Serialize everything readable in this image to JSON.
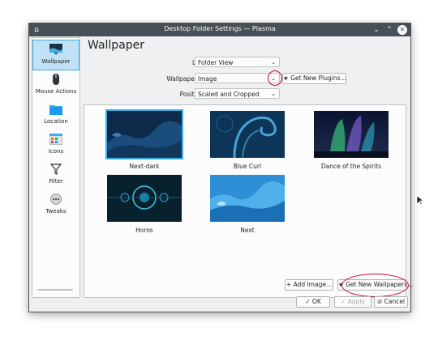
{
  "window": {
    "title": "Desktop Folder Settings — Plasma"
  },
  "titlebar_icons": [
    "pin-icon",
    "minimize-icon",
    "maximize-icon",
    "close-icon"
  ],
  "sidebar": {
    "items": [
      {
        "label": "Wallpaper",
        "icon": "wallpaper-icon",
        "active": true
      },
      {
        "label": "Mouse Actions",
        "icon": "mouse-icon",
        "active": false
      },
      {
        "label": "Location",
        "icon": "folder-icon",
        "active": false
      },
      {
        "label": "Icons",
        "icon": "icons-grid-icon",
        "active": false
      },
      {
        "label": "Filter",
        "icon": "filter-icon",
        "active": false
      },
      {
        "label": "Tweaks",
        "icon": "tweaks-icon",
        "active": false
      }
    ]
  },
  "page": {
    "title": "Wallpaper"
  },
  "form": {
    "layout_label": "Layout:",
    "layout_value": "Folder View",
    "wallpaper_type_label": "Wallpaper Type:",
    "wallpaper_type_value": "Image",
    "get_plugins_label": "Get New Plugins...",
    "positioning_label": "Positioning:",
    "positioning_value": "Scaled and Cropped"
  },
  "wallpapers": [
    {
      "name": "Next-dark",
      "selected": true
    },
    {
      "name": "Blue Curl",
      "selected": false
    },
    {
      "name": "Dance of the Spirits",
      "selected": false
    },
    {
      "name": "Horos",
      "selected": false
    },
    {
      "name": "Next",
      "selected": false
    }
  ],
  "buttons": {
    "add_image": "Add Image...",
    "get_wallpapers": "Get New Wallpapers...",
    "ok": "OK",
    "apply": "Apply",
    "cancel": "Cancel"
  },
  "colors": {
    "titlebar": "#475057",
    "accent": "#3daee9",
    "annotation": "#d0021b"
  }
}
